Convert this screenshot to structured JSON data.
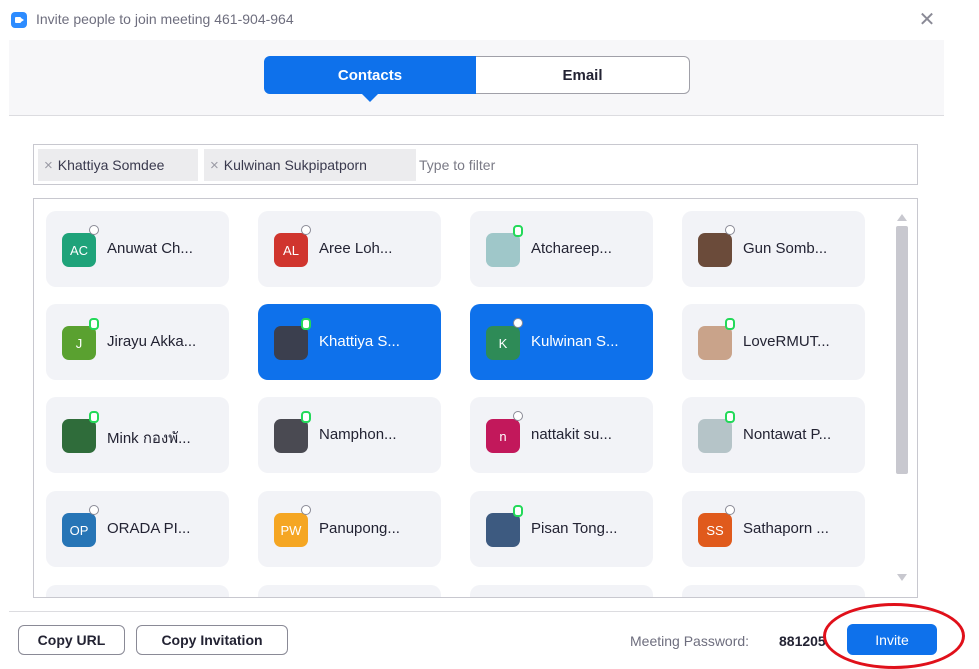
{
  "window": {
    "title": "Invite people to join meeting 461-904-964"
  },
  "tabs": [
    {
      "label": "Contacts",
      "selected": true
    },
    {
      "label": "Email",
      "selected": false
    }
  ],
  "filter": {
    "chips": [
      "Khattiya Somdee",
      "Kulwinan Sukpipatporn"
    ],
    "placeholder": "Type to filter",
    "remove_glyph": "×"
  },
  "contacts": [
    {
      "name": "Anuwat Ch...",
      "initials": "AC",
      "color": "#1fa37a",
      "presence": "offline",
      "selected": false
    },
    {
      "name": "Aree Loh...",
      "initials": "AL",
      "color": "#d0352e",
      "presence": "offline",
      "selected": false
    },
    {
      "name": "Atchareep...",
      "initials": "",
      "color": "#9fc7c9",
      "presence": "online",
      "selected": false
    },
    {
      "name": "Gun Somb...",
      "initials": "",
      "color": "#6b4b3a",
      "presence": "offline",
      "selected": false
    },
    {
      "name": "Jirayu Akka...",
      "initials": "J",
      "color": "#5aa130",
      "presence": "online",
      "selected": false
    },
    {
      "name": "Khattiya S...",
      "initials": "",
      "color": "#3b3f4e",
      "presence": "online",
      "selected": true
    },
    {
      "name": "Kulwinan S...",
      "initials": "K",
      "color": "#2e8b57",
      "presence": "offline",
      "selected": true
    },
    {
      "name": "LoveRMUT...",
      "initials": "",
      "color": "#c9a38a",
      "presence": "online",
      "selected": false
    },
    {
      "name": "Mink กองพั...",
      "initials": "",
      "color": "#2f6c3a",
      "presence": "online",
      "selected": false
    },
    {
      "name": "Namphon...",
      "initials": "",
      "color": "#4a4a52",
      "presence": "online",
      "selected": false
    },
    {
      "name": "nattakit su...",
      "initials": "n",
      "color": "#c2185b",
      "presence": "offline",
      "selected": false
    },
    {
      "name": "Nontawat P...",
      "initials": "",
      "color": "#b5c4c8",
      "presence": "online",
      "selected": false
    },
    {
      "name": "ORADA PI...",
      "initials": "OP",
      "color": "#2775b6",
      "presence": "offline",
      "selected": false
    },
    {
      "name": "Panupong...",
      "initials": "PW",
      "color": "#f5a623",
      "presence": "offline",
      "selected": false
    },
    {
      "name": "Pisan Tong...",
      "initials": "",
      "color": "#3d5a80",
      "presence": "online",
      "selected": false
    },
    {
      "name": "Sathaporn ...",
      "initials": "SS",
      "color": "#e05a1c",
      "presence": "offline",
      "selected": false
    }
  ],
  "footer": {
    "copy_url": "Copy URL",
    "copy_invitation": "Copy Invitation",
    "password_label": "Meeting Password:",
    "password_value": "881205",
    "invite": "Invite"
  },
  "annotation_color": "#e0101a"
}
